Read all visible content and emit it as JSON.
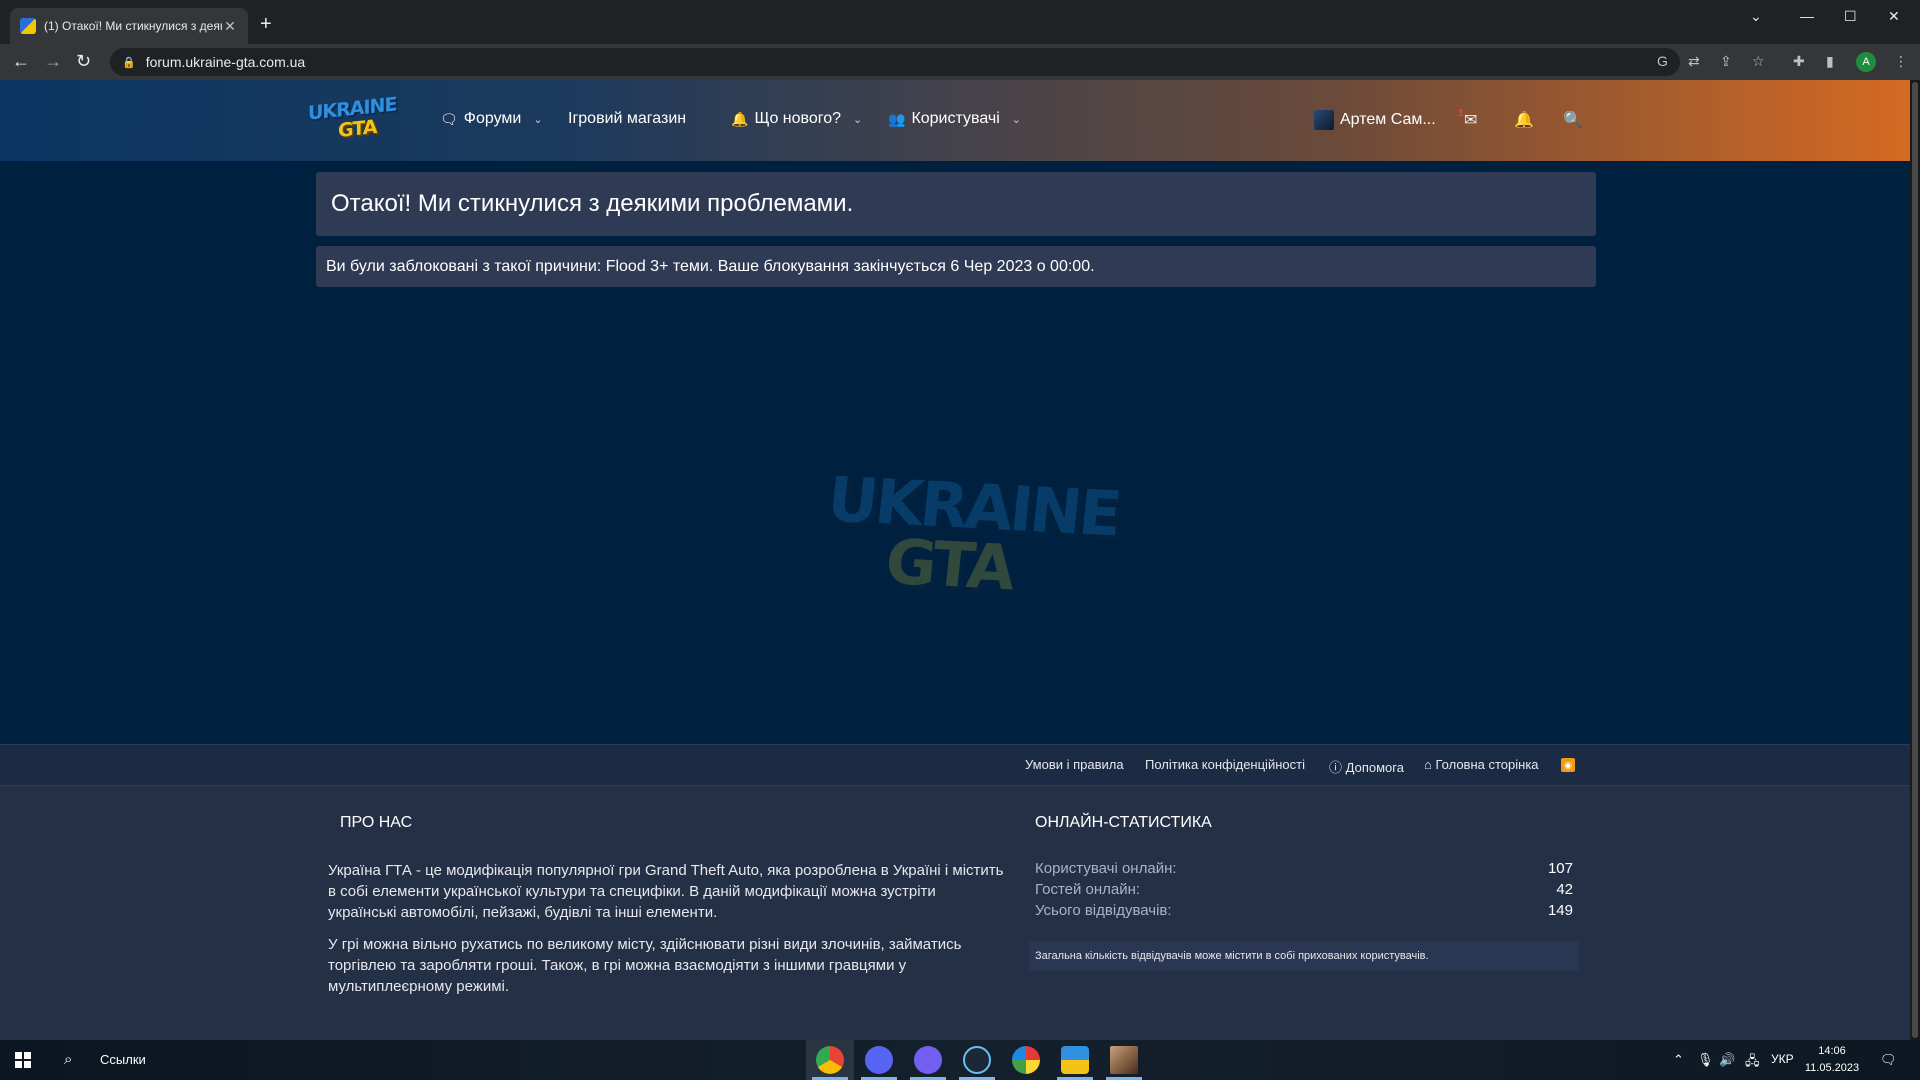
{
  "browser": {
    "tab_title": "(1) Отакої! Ми стикнулися з деякими проблемами.",
    "tab_close": "✕",
    "new_tab": "+",
    "url": "forum.ukraine-gta.com.ua",
    "profile_initial": "A"
  },
  "site": {
    "logo_line1": "UKRAINE",
    "logo_line2": "GTA",
    "nav": {
      "forums": "Форуми",
      "store": "Ігровий магазин",
      "whats_new": "Що нового?",
      "members": "Користувачі"
    },
    "user_name": "Артем Сам...",
    "inbox_badge": "1"
  },
  "notice": {
    "title": "Отакої! Ми стикнулися з деякими проблемами.",
    "message": "Ви були заблоковані з такої причини: Flood 3+ теми. Ваше блокування закінчується 6 Чер 2023 о 00:00."
  },
  "watermark": {
    "line1": "UKRAINE",
    "line2": "GTA"
  },
  "footer_links": {
    "terms": "Умови і правила",
    "privacy": "Політика конфіденційності",
    "help": "Допомога",
    "home": "Головна сторінка"
  },
  "about": {
    "heading": "ПРО НАС",
    "paragraph1": "Україна ГТА - це модифікація популярної гри Grand Theft Auto, яка розроблена в Україні і містить в собі елементи української культури та специфіки. В даній модифікації можна зустріти українські автомобілі, пейзажі, будівлі та інші елементи.",
    "paragraph2": "У грі можна вільно рухатись по великому місту, здійснювати різні види злочинів, займатись торгівлею та заробляти гроші. Також, в грі можна взаємодіяти з іншими гравцями у мультиплеєрному режимі."
  },
  "stats": {
    "heading": "ОНЛАЙН-СТАТИСТИКА",
    "rows": [
      {
        "label": "Користувачі онлайн:",
        "value": "107"
      },
      {
        "label": "Гостей онлайн:",
        "value": "42"
      },
      {
        "label": "Усього відвідувачів:",
        "value": "149"
      }
    ],
    "note": "Загальна кількість відвідувачів може містити в собі прихованих користувачів."
  },
  "taskbar": {
    "search_label": "Ссылки",
    "language": "УКР",
    "time": "14:06",
    "date": "11.05.2023"
  },
  "colors": {
    "page_bg": "#00203f",
    "notice_bg": "#2f3b55",
    "footer_bg": "#243046",
    "header_accent": "#d66a22"
  }
}
